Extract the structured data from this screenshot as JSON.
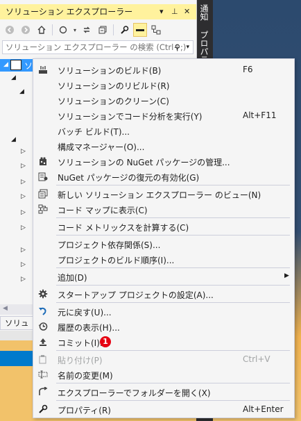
{
  "colors": {
    "accent": "#007acc",
    "highlight_tab": "#fff29d",
    "selection": "#3399ff",
    "badge": "#e60012"
  },
  "side_tabs": {
    "notifications": "通知",
    "properties": "プロパティ"
  },
  "solution_explorer": {
    "title": "ソリューション エクスプローラー",
    "title_buttons": [
      "▾",
      "⊥",
      "✕"
    ],
    "search_placeholder": "ソリューション エクスプローラー の検索 (Ctrl+;)",
    "search_icon": "⚲",
    "search_dropdown": "▾",
    "selected_item_label": "ソ",
    "tab_label": "ソリュー..."
  },
  "toolbar_icons": [
    "back-icon",
    "forward-icon",
    "home-icon",
    "sync-icon",
    "dropdown-icon",
    "refresh-icon",
    "collapse-all-icon",
    "wrench-icon",
    "preview-icon",
    "node-icon"
  ],
  "context_menu": {
    "items": [
      {
        "label": "ソリューションのビルド(B)",
        "shortcut": "F6",
        "icon": "build-icon"
      },
      {
        "label": "ソリューションのリビルド(R)",
        "shortcut": "",
        "icon": ""
      },
      {
        "label": "ソリューションのクリーン(C)",
        "shortcut": "",
        "icon": ""
      },
      {
        "label": "ソリューションでコード分析を実行(Y)",
        "shortcut": "Alt+F11",
        "icon": ""
      },
      {
        "label": "バッチ ビルド(T)...",
        "shortcut": "",
        "icon": ""
      },
      {
        "label": "構成マネージャー(O)...",
        "shortcut": "",
        "icon": ""
      },
      {
        "label": "ソリューションの NuGet パッケージの管理...",
        "shortcut": "",
        "icon": "nuget-icon"
      },
      {
        "label": "NuGet パッケージの復元の有効化(G)",
        "shortcut": "",
        "icon": "package-restore-icon"
      },
      {
        "label": "新しい ソリューション エクスプローラー のビュー(N)",
        "shortcut": "",
        "icon": "new-view-icon"
      },
      {
        "label": "コード マップに表示(C)",
        "shortcut": "",
        "icon": "code-map-icon"
      },
      {
        "label": "コード メトリックスを計算する(C)",
        "shortcut": "",
        "icon": ""
      },
      {
        "label": "プロジェクト依存関係(S)...",
        "shortcut": "",
        "icon": ""
      },
      {
        "label": "プロジェクトのビルド順序(I)...",
        "shortcut": "",
        "icon": ""
      },
      {
        "label": "追加(D)",
        "shortcut": "",
        "icon": "",
        "submenu": "▶"
      },
      {
        "label": "スタートアップ プロジェクトの設定(A)...",
        "shortcut": "",
        "icon": "gear-icon"
      },
      {
        "label": "元に戻す(U)...",
        "shortcut": "",
        "icon": "undo-icon"
      },
      {
        "label": "履歴の表示(H)...",
        "shortcut": "",
        "icon": "history-icon"
      },
      {
        "label": "コミット(I)...",
        "shortcut": "",
        "icon": "commit-icon",
        "badge": "1"
      },
      {
        "label": "貼り付け(P)",
        "shortcut": "Ctrl+V",
        "icon": "paste-icon",
        "disabled": true
      },
      {
        "label": "名前の変更(M)",
        "shortcut": "",
        "icon": "rename-icon"
      },
      {
        "label": "エクスプローラーでフォルダーを開く(X)",
        "shortcut": "",
        "icon": "open-folder-icon"
      },
      {
        "label": "プロパティ(R)",
        "shortcut": "Alt+Enter",
        "icon": "wrench-icon"
      }
    ]
  }
}
